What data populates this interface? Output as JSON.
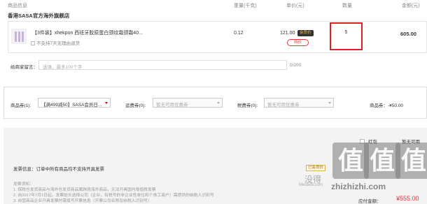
{
  "header": {
    "product_info": "商品信息",
    "weight": "重量(千克)",
    "unit_price": "单价(元)",
    "quantity": "数量",
    "amount": "金额(元)"
  },
  "store": {
    "name": "香港SASA官方海外旗舰店"
  },
  "item": {
    "name": "【3件装】xhekpon 西班牙胶原蛋白颈纹霜颈霜40...",
    "no_return": "不支持7天无理由退货",
    "weight": "0.12",
    "price": "121.00",
    "vip_badge": "会员价",
    "special_tag": "特价",
    "quantity": "5",
    "amount": "605.00"
  },
  "message": {
    "label": "给商家留言：",
    "placeholder": "选填，最多100个字",
    "count": "0/200"
  },
  "coupons": {
    "product_label": "商品券(1):",
    "product_selected": "【满499减50】SASA会员日...",
    "shipping_label": "运费券(0):",
    "shipping_selected": "暂无可用优惠券",
    "tax_label": "税费券(0):",
    "tax_selected": "暂无可用优惠券",
    "total": "商品券：-¥50.00"
  },
  "redpack": {
    "label": "红包",
    "status": "暂无可用"
  },
  "invoice": {
    "text": "发票信息：订单中所有商品均不支持开具发票",
    "notice_title": "发票须知：",
    "notice_1": "1. 保税仓发货商品与海外仓发货商品属跨境海外商品，无法开具国内增值税发票",
    "notice_2": "2. 自2017年7月1日起，发票抬头选择公司（企业，有税号的非企业性单位和个体工商户）需提供的纳税人识别号",
    "notice_3": "3. 自营商品企业开具发票时需填写开票信息（开票公司名称及纳税人识别号）"
  },
  "member_badge": "已会员价",
  "watermark": {
    "chars": [
      "值",
      "值",
      "值"
    ],
    "side": "没得",
    "url": "zhizhizhi.com",
    "site": "Meidebi.com"
  },
  "payment": {
    "label": "应付金额：",
    "amount": "¥555.00"
  }
}
